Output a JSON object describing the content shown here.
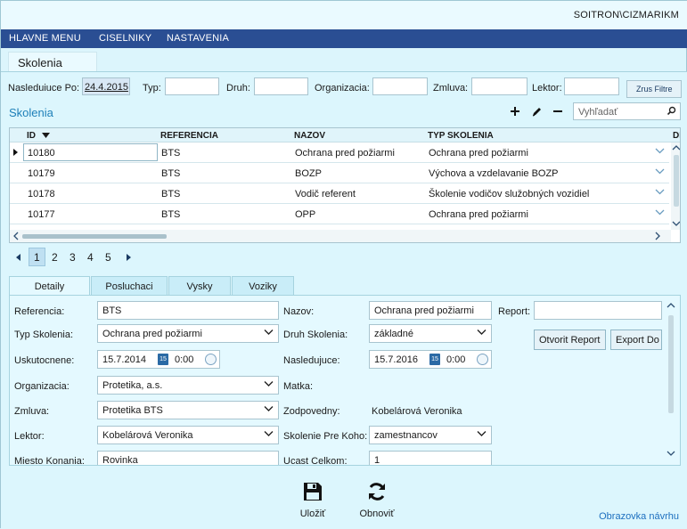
{
  "header": {
    "user": "SOITRON\\CIZMARIKM"
  },
  "menu": {
    "items": [
      {
        "label": "HLAVNE MENU"
      },
      {
        "label": "CISELNIKY"
      },
      {
        "label": "NASTAVENIA"
      }
    ]
  },
  "document_tab": {
    "label": "Skolenia"
  },
  "filter": {
    "nasleduiuce_label": "Nasleduiuce Po:",
    "nasleduiuce_value": "24.4.2015",
    "typ_label": "Typ:",
    "druh_label": "Druh:",
    "organizacia_label": "Organizacia:",
    "zmluva_label": "Zmluva:",
    "lektor_label": "Lektor:",
    "button_label": "Zrus Filtre"
  },
  "section": {
    "title": "Skolenia",
    "search_placeholder": "Vyhľadať"
  },
  "grid": {
    "columns": [
      "ID",
      "REFERENCIA",
      "NAZOV",
      "TYP SKOLENIA",
      "DE"
    ],
    "rows": [
      {
        "id": "10180",
        "referencia": "BTS",
        "nazov": "Ochrana pred požiarmi",
        "typ": "Ochrana pred požiarmi"
      },
      {
        "id": "10179",
        "referencia": "BTS",
        "nazov": "BOZP",
        "typ": "Výchova a vzdelavanie BOZP"
      },
      {
        "id": "10178",
        "referencia": "BTS",
        "nazov": "Vodič referent",
        "typ": "Školenie vodičov služobných vozidiel"
      },
      {
        "id": "10177",
        "referencia": "BTS",
        "nazov": "OPP",
        "typ": "Ochrana pred požiarmi"
      }
    ]
  },
  "pager": {
    "pages": [
      "1",
      "2",
      "3",
      "4",
      "5"
    ],
    "current": "1"
  },
  "detail_tabs": [
    {
      "label": "Detaily"
    },
    {
      "label": "Posluchaci"
    },
    {
      "label": "Vysky"
    },
    {
      "label": "Voziky"
    }
  ],
  "detail": {
    "referencia_label": "Referencia:",
    "referencia_value": "BTS",
    "typ_label": "Typ Skolenia:",
    "typ_value": "Ochrana pred požiarmi",
    "uskutocnene_label": "Uskutocnene:",
    "uskutocnene_date": "15.7.2014",
    "uskutocnene_time": "0:00",
    "organizacia_label": "Organizacia:",
    "organizacia_value": "Protetika, a.s.",
    "zmluva_label": "Zmluva:",
    "zmluva_value": "Protetika BTS",
    "lektor_label": "Lektor:",
    "lektor_value": "Kobelárová Veronika",
    "miesto_label": "Miesto Konania:",
    "miesto_value": "Rovinka",
    "nazov_label": "Nazov:",
    "nazov_value": "Ochrana pred požiarmi",
    "druh_label": "Druh Skolenia:",
    "druh_value": "základné",
    "nasledujuce_label": "Nasledujuce:",
    "nasledujuce_date": "15.7.2016",
    "nasledujuce_time": "0:00",
    "matka_label": "Matka:",
    "zodpovedny_label": "Zodpovedny:",
    "zodpovedny_value": "Kobelárová Veronika",
    "pre_koho_label": "Skolenie Pre Koho:",
    "pre_koho_value": "zamestnancov",
    "ucast_label": "Ucast Celkom:",
    "ucast_value": "1",
    "report_label": "Report:",
    "otvorit_report": "Otvorit Report",
    "export_label": "Export Do Wordu",
    "calendar_day": "15"
  },
  "footer": {
    "save_label": "Uložiť",
    "refresh_label": "Obnoviť",
    "design_link": "Obrazovka návrhu"
  }
}
